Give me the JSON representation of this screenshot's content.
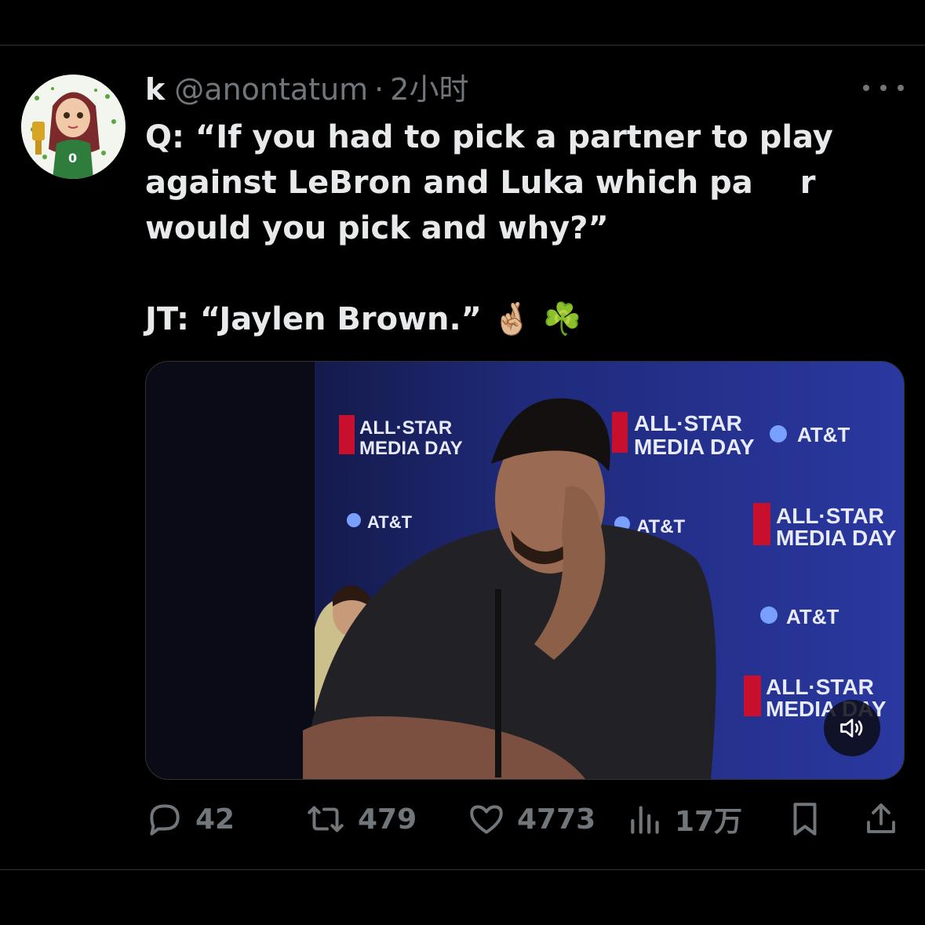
{
  "author": {
    "display_name": "k",
    "handle": "@anontatum",
    "separator": "·",
    "time": "2小时"
  },
  "tweet": {
    "lines_q": [
      "Q: “If you had to pick a partner to play",
      "against LeBron and Luka which pa   r",
      "would you pick and why?”"
    ],
    "line_jt": "JT: “Jaylen Brown.” 🤞🏼 ☘️"
  },
  "video": {
    "backdrop_texts": [
      "ALL·STAR",
      "MEDIA DAY",
      "AT&T",
      "ALL·STAR",
      "MEDIA DAY",
      "AT&T",
      "AT&T",
      "ALL·STAR",
      "MEDIA DAY",
      "AT&T",
      "ALL·STAR",
      "MEDIA DAY"
    ],
    "sound_icon": "speaker-icon"
  },
  "actions": {
    "replies": "42",
    "retweets": "479",
    "likes": "4773",
    "views": "17万"
  },
  "colors": {
    "background": "#000000",
    "text": "#e7e9ea",
    "muted": "#71767b",
    "divider": "#2f3336",
    "backdrop_blue": "#1f2a7a"
  },
  "icons": [
    "reply-icon",
    "retweet-icon",
    "like-icon",
    "views-icon",
    "bookmark-icon",
    "share-icon",
    "more-icon"
  ]
}
